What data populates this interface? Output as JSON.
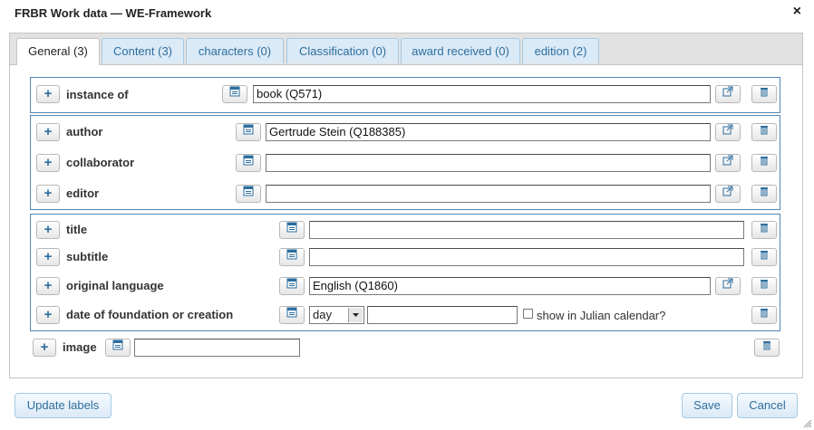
{
  "dialog": {
    "title": "FRBR Work data — WE-Framework"
  },
  "tabs": [
    {
      "label": "General (3)"
    },
    {
      "label": "Content (3)"
    },
    {
      "label": "characters (0)"
    },
    {
      "label": "Classification (0)"
    },
    {
      "label": "award received (0)"
    },
    {
      "label": "edition (2)"
    }
  ],
  "fields": {
    "instance_of": {
      "label": "instance of",
      "value": "book (Q571)"
    },
    "author": {
      "label": "author",
      "value": "Gertrude Stein (Q188385)"
    },
    "collaborator": {
      "label": "collaborator",
      "value": ""
    },
    "editor": {
      "label": "editor",
      "value": ""
    },
    "title": {
      "label": "title",
      "value": ""
    },
    "subtitle": {
      "label": "subtitle",
      "value": ""
    },
    "original_language": {
      "label": "original language",
      "value": "English (Q1860)"
    },
    "date_of_foundation": {
      "label": "date of foundation or creation",
      "precision": "day",
      "value": "",
      "julian_label": "show in Julian calendar?",
      "julian_checked": false
    },
    "image": {
      "label": "image",
      "value": ""
    }
  },
  "buttons": {
    "update_labels": "Update labels",
    "save": "Save",
    "cancel": "Cancel",
    "add_symbol": "+"
  },
  "icons": {
    "close": "×",
    "select": "select-value-icon",
    "open_link": "external-link-icon",
    "delete": "trash-icon"
  }
}
